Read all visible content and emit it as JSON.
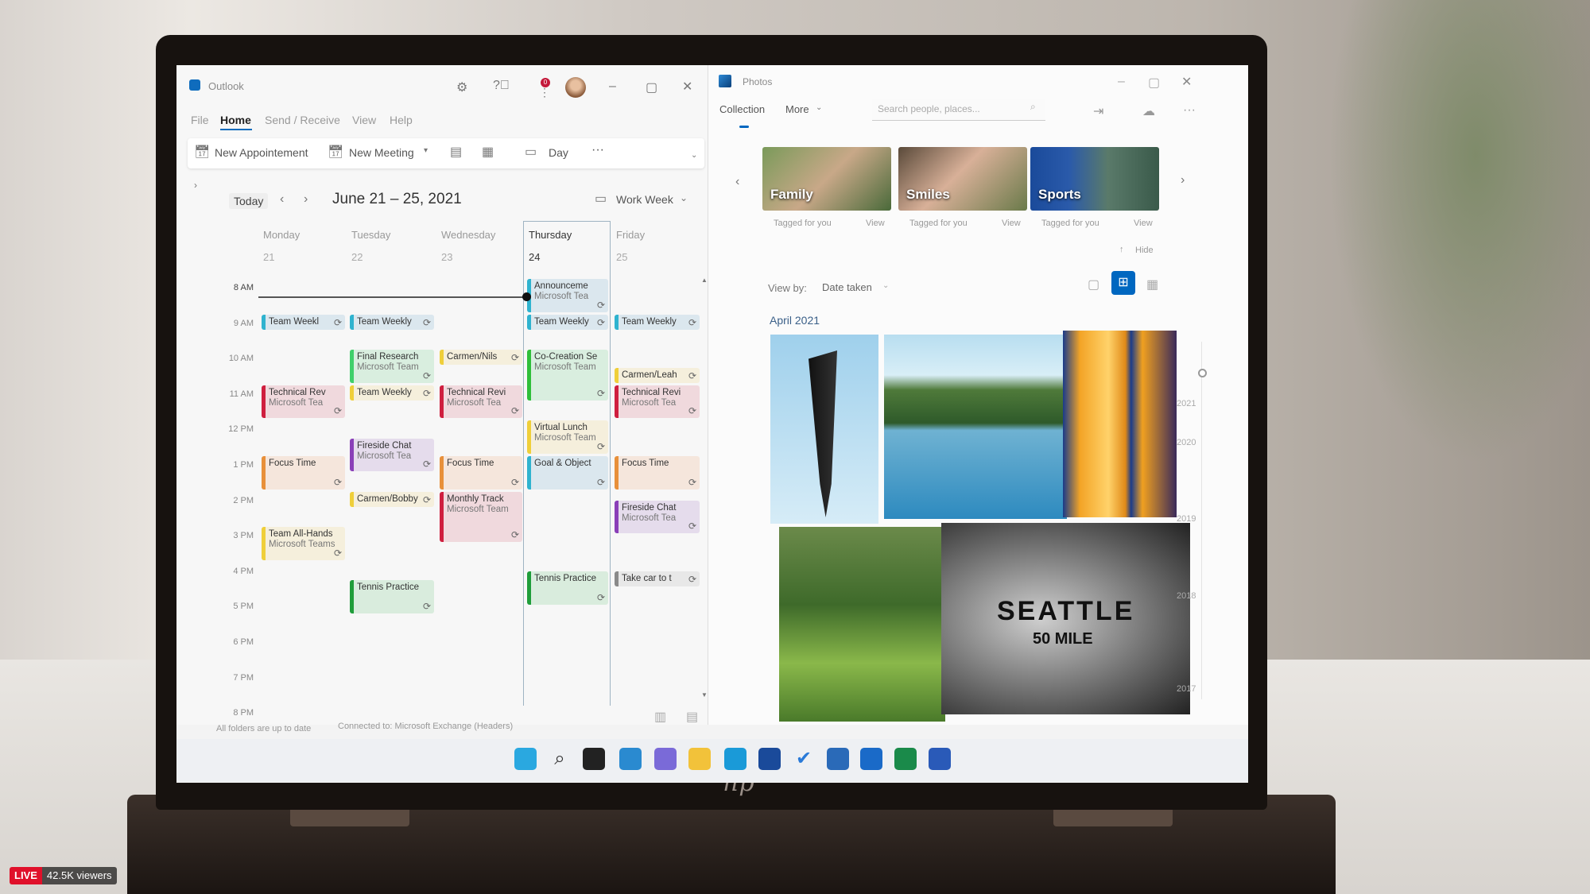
{
  "outlook": {
    "title": "Outlook",
    "notification_count": "0",
    "menu": [
      "File",
      "Home",
      "Send / Receive",
      "View",
      "Help"
    ],
    "active_menu": "Home",
    "toolbar": {
      "new_appointment": "New Appointement",
      "new_meeting": "New Meeting",
      "day": "Day",
      "more": "···"
    },
    "nav": {
      "today": "Today",
      "range": "June 21 – 25, 2021",
      "view": "Work Week"
    },
    "days": [
      {
        "name": "Monday",
        "date": "21"
      },
      {
        "name": "Tuesday",
        "date": "22"
      },
      {
        "name": "Wednesday",
        "date": "23"
      },
      {
        "name": "Thursday",
        "date": "24",
        "today": true
      },
      {
        "name": "Friday",
        "date": "25"
      }
    ],
    "hours": [
      "8 AM",
      "9 AM",
      "10 AM",
      "11 AM",
      "12 PM",
      "1 PM",
      "2 PM",
      "3 PM",
      "4 PM",
      "5 PM",
      "6 PM",
      "7 PM",
      "8 PM"
    ],
    "current_time_hour": 8.5,
    "events": [
      {
        "day": 0,
        "title": "Team Weekl",
        "start": 9,
        "end": 9.5,
        "color": "#2fb3cf",
        "bg": "#dbe7ee"
      },
      {
        "day": 0,
        "title": "Technical Rev",
        "sub": "Microsoft Tea",
        "start": 11,
        "end": 12,
        "color": "#cf1f3f",
        "bg": "#f0d9dd"
      },
      {
        "day": 0,
        "title": "Focus Time",
        "start": 13,
        "end": 14,
        "color": "#e8903a",
        "bg": "#f5e6dc"
      },
      {
        "day": 0,
        "title": "Team All-Hands",
        "sub": "Microsoft Teams",
        "start": 15,
        "end": 16,
        "color": "#efcf3a",
        "bg": "#f5efdc"
      },
      {
        "day": 1,
        "title": "Team Weekly",
        "start": 9,
        "end": 9.5,
        "color": "#2fb3cf",
        "bg": "#dbe7ee"
      },
      {
        "day": 1,
        "title": "Final Research",
        "sub": "Microsoft Team",
        "start": 10,
        "end": 11,
        "color": "#3fd06a",
        "bg": "#d9eedf"
      },
      {
        "day": 1,
        "title": "Team Weekly",
        "start": 11,
        "end": 11.5,
        "color": "#efcf3a",
        "bg": "#f5efdc"
      },
      {
        "day": 1,
        "title": "Fireside Chat",
        "sub": "Microsoft Tea",
        "start": 12.5,
        "end": 13.5,
        "color": "#8a3fb8",
        "bg": "#e5dcec"
      },
      {
        "day": 1,
        "title": "Carmen/Bobby",
        "start": 14,
        "end": 14.5,
        "color": "#efcf3a",
        "bg": "#f5efdc"
      },
      {
        "day": 1,
        "title": "Tennis Practice",
        "start": 16.5,
        "end": 17.5,
        "color": "#1f9d3a",
        "bg": "#d9ecdd"
      },
      {
        "day": 2,
        "title": "Carmen/Nils",
        "start": 10,
        "end": 10.5,
        "color": "#efcf3a",
        "bg": "#f5efdc"
      },
      {
        "day": 2,
        "title": "Technical Revi",
        "sub": "Microsoft Tea",
        "start": 11,
        "end": 12,
        "color": "#cf1f3f",
        "bg": "#f0d9dd"
      },
      {
        "day": 2,
        "title": "Focus Time",
        "start": 13,
        "end": 14,
        "color": "#e8903a",
        "bg": "#f5e6dc"
      },
      {
        "day": 2,
        "title": "Monthly Track",
        "sub": "Microsoft Team",
        "start": 14,
        "end": 15.5,
        "color": "#cf1f3f",
        "bg": "#f0d9dd"
      },
      {
        "day": 3,
        "title": "Announceme",
        "sub": "Microsoft Tea",
        "start": 8,
        "end": 9,
        "color": "#2fb3cf",
        "bg": "#dbe7ee"
      },
      {
        "day": 3,
        "title": "Team Weekly",
        "start": 9,
        "end": 9.5,
        "color": "#2fb3cf",
        "bg": "#dbe7ee"
      },
      {
        "day": 3,
        "title": "Co-Creation Se",
        "sub": "Microsoft Team",
        "start": 10,
        "end": 11.5,
        "color": "#2fbf3a",
        "bg": "#d9eedf"
      },
      {
        "day": 3,
        "title": "Virtual Lunch",
        "sub": "Microsoft Team",
        "start": 12,
        "end": 13,
        "color": "#efcf3a",
        "bg": "#f5efdc"
      },
      {
        "day": 3,
        "title": "Goal & Object",
        "start": 13,
        "end": 14,
        "color": "#2fb3cf",
        "bg": "#dbe7ee"
      },
      {
        "day": 3,
        "title": "Tennis Practice",
        "start": 16.25,
        "end": 17.25,
        "color": "#1f9d3a",
        "bg": "#d9ecdd"
      },
      {
        "day": 4,
        "title": "Team Weekly",
        "start": 9,
        "end": 9.5,
        "color": "#2fb3cf",
        "bg": "#dbe7ee"
      },
      {
        "day": 4,
        "title": "Carmen/Leah",
        "start": 10.5,
        "end": 11,
        "color": "#efcf3a",
        "bg": "#f5efdc"
      },
      {
        "day": 4,
        "title": "Technical Revi",
        "sub": "Microsoft Tea",
        "start": 11,
        "end": 12,
        "color": "#cf1f3f",
        "bg": "#f0d9dd"
      },
      {
        "day": 4,
        "title": "Focus Time",
        "start": 13,
        "end": 14,
        "color": "#e8903a",
        "bg": "#f5e6dc"
      },
      {
        "day": 4,
        "title": "Fireside Chat",
        "sub": "Microsoft Tea",
        "start": 14.25,
        "end": 15.25,
        "color": "#8a3fb8",
        "bg": "#e5dcec"
      },
      {
        "day": 4,
        "title": "Take car to t",
        "start": 16.25,
        "end": 16.75,
        "color": "#8a8a8a",
        "bg": "#e8e8e8"
      }
    ],
    "status": {
      "sync": "All folders are up to date",
      "connection": "Connected to: Microsoft Exchange (Headers)"
    }
  },
  "photos": {
    "title": "Photos",
    "tabs": [
      "Collection",
      "More"
    ],
    "search_placeholder": "Search people, places...",
    "people": [
      {
        "label": "Family",
        "caption": "Tagged for you",
        "action": "View"
      },
      {
        "label": "Smiles",
        "caption": "Tagged for you",
        "action": "View"
      },
      {
        "label": "Sports",
        "caption": "Tagged for you",
        "action": "View"
      }
    ],
    "hide": "Hide",
    "view_by_label": "View by:",
    "view_by_value": "Date taken",
    "group": "April 2021",
    "timeline": [
      "2021",
      "2020",
      "2019",
      "2018",
      "2017"
    ],
    "accent": "#0067c0"
  },
  "photo_sign": {
    "line1": "SEATTLE",
    "line2": "50 MILE"
  },
  "taskbar": [
    "start",
    "search",
    "task-view",
    "widgets",
    "chat",
    "file-explorer",
    "edge",
    "store",
    "todo",
    "photos",
    "outlook",
    "excel",
    "word"
  ],
  "stream": {
    "live": "LIVE",
    "viewers": "42.5K viewers"
  },
  "brand": "hp"
}
